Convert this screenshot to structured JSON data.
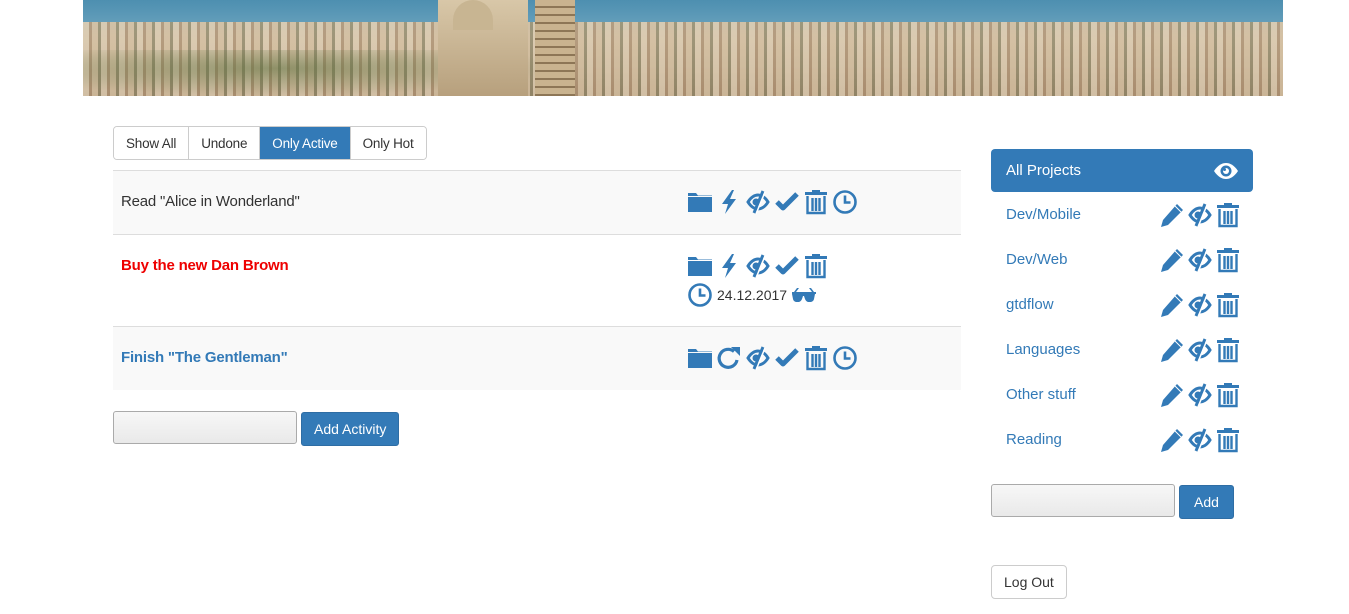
{
  "banner": {
    "alt": "Marseille city panorama"
  },
  "filters": [
    {
      "label": "Show All",
      "active": false
    },
    {
      "label": "Undone",
      "active": false
    },
    {
      "label": "Only Active",
      "active": true
    },
    {
      "label": "Only Hot",
      "active": false
    }
  ],
  "activities": [
    {
      "title": "Read \"Alice in Wonderland\"",
      "style": "normal",
      "icons": [
        "folder-icon",
        "bolt-icon",
        "eye-slash-icon",
        "check-icon",
        "trash-icon",
        "clock-icon"
      ]
    },
    {
      "title": "Buy the new Dan Brown",
      "style": "hot",
      "icons": [
        "folder-icon",
        "bolt-icon",
        "eye-slash-icon",
        "check-icon",
        "trash-icon"
      ],
      "due_date": "24.12.2017"
    },
    {
      "title": "Finish \"The Gentleman\"",
      "style": "link",
      "icons": [
        "folder-icon",
        "refresh-icon",
        "eye-slash-icon",
        "check-icon",
        "trash-icon",
        "clock-icon"
      ]
    }
  ],
  "add_activity": {
    "input_value": "",
    "button_label": "Add Activity"
  },
  "projects": {
    "all_label": "All Projects",
    "items": [
      {
        "name": "Dev/Mobile"
      },
      {
        "name": "Dev/Web"
      },
      {
        "name": "gtdflow"
      },
      {
        "name": "Languages"
      },
      {
        "name": "Other stuff"
      },
      {
        "name": "Reading"
      }
    ]
  },
  "add_project": {
    "input_value": "",
    "button_label": "Add"
  },
  "logout_label": "Log Out",
  "colors": {
    "primary": "#337ab7",
    "hot": "#ee0000",
    "text": "#333333",
    "stripe": "#f9f9f9"
  }
}
